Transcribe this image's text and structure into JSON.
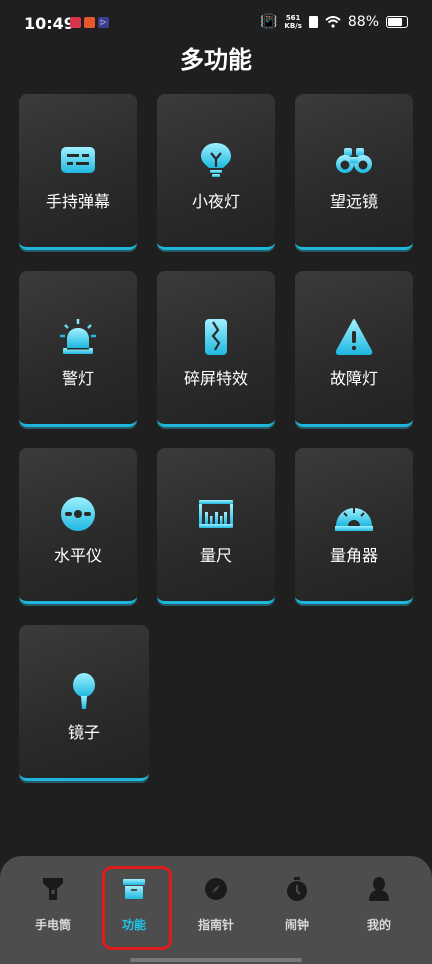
{
  "status_bar": {
    "time": "10:49",
    "net_speed_value": "561",
    "net_speed_unit": "KB/s",
    "battery": "88%"
  },
  "page_title": "多功能",
  "features": [
    {
      "label": "手持弹幕",
      "icon": "subtitles-icon"
    },
    {
      "label": "小夜灯",
      "icon": "bulb-icon"
    },
    {
      "label": "望远镜",
      "icon": "binoculars-icon"
    },
    {
      "label": "警灯",
      "icon": "siren-icon"
    },
    {
      "label": "碎屏特效",
      "icon": "cracked-phone-icon"
    },
    {
      "label": "故障灯",
      "icon": "warning-icon"
    },
    {
      "label": "水平仪",
      "icon": "level-icon"
    },
    {
      "label": "量尺",
      "icon": "ruler-icon"
    },
    {
      "label": "量角器",
      "icon": "protractor-icon"
    },
    {
      "label": "镜子",
      "icon": "hand-mirror-icon"
    }
  ],
  "nav": [
    {
      "label": "手电筒",
      "icon": "flashlight-icon"
    },
    {
      "label": "功能",
      "icon": "box-icon",
      "active": true
    },
    {
      "label": "指南针",
      "icon": "compass-icon"
    },
    {
      "label": "闹钟",
      "icon": "stopwatch-icon"
    },
    {
      "label": "我的",
      "icon": "person-icon"
    }
  ],
  "colors": {
    "accent": "#20c3ea",
    "background": "#1f1f1f",
    "nav_background": "#4d4d4d",
    "highlight": "#e21b1b"
  }
}
